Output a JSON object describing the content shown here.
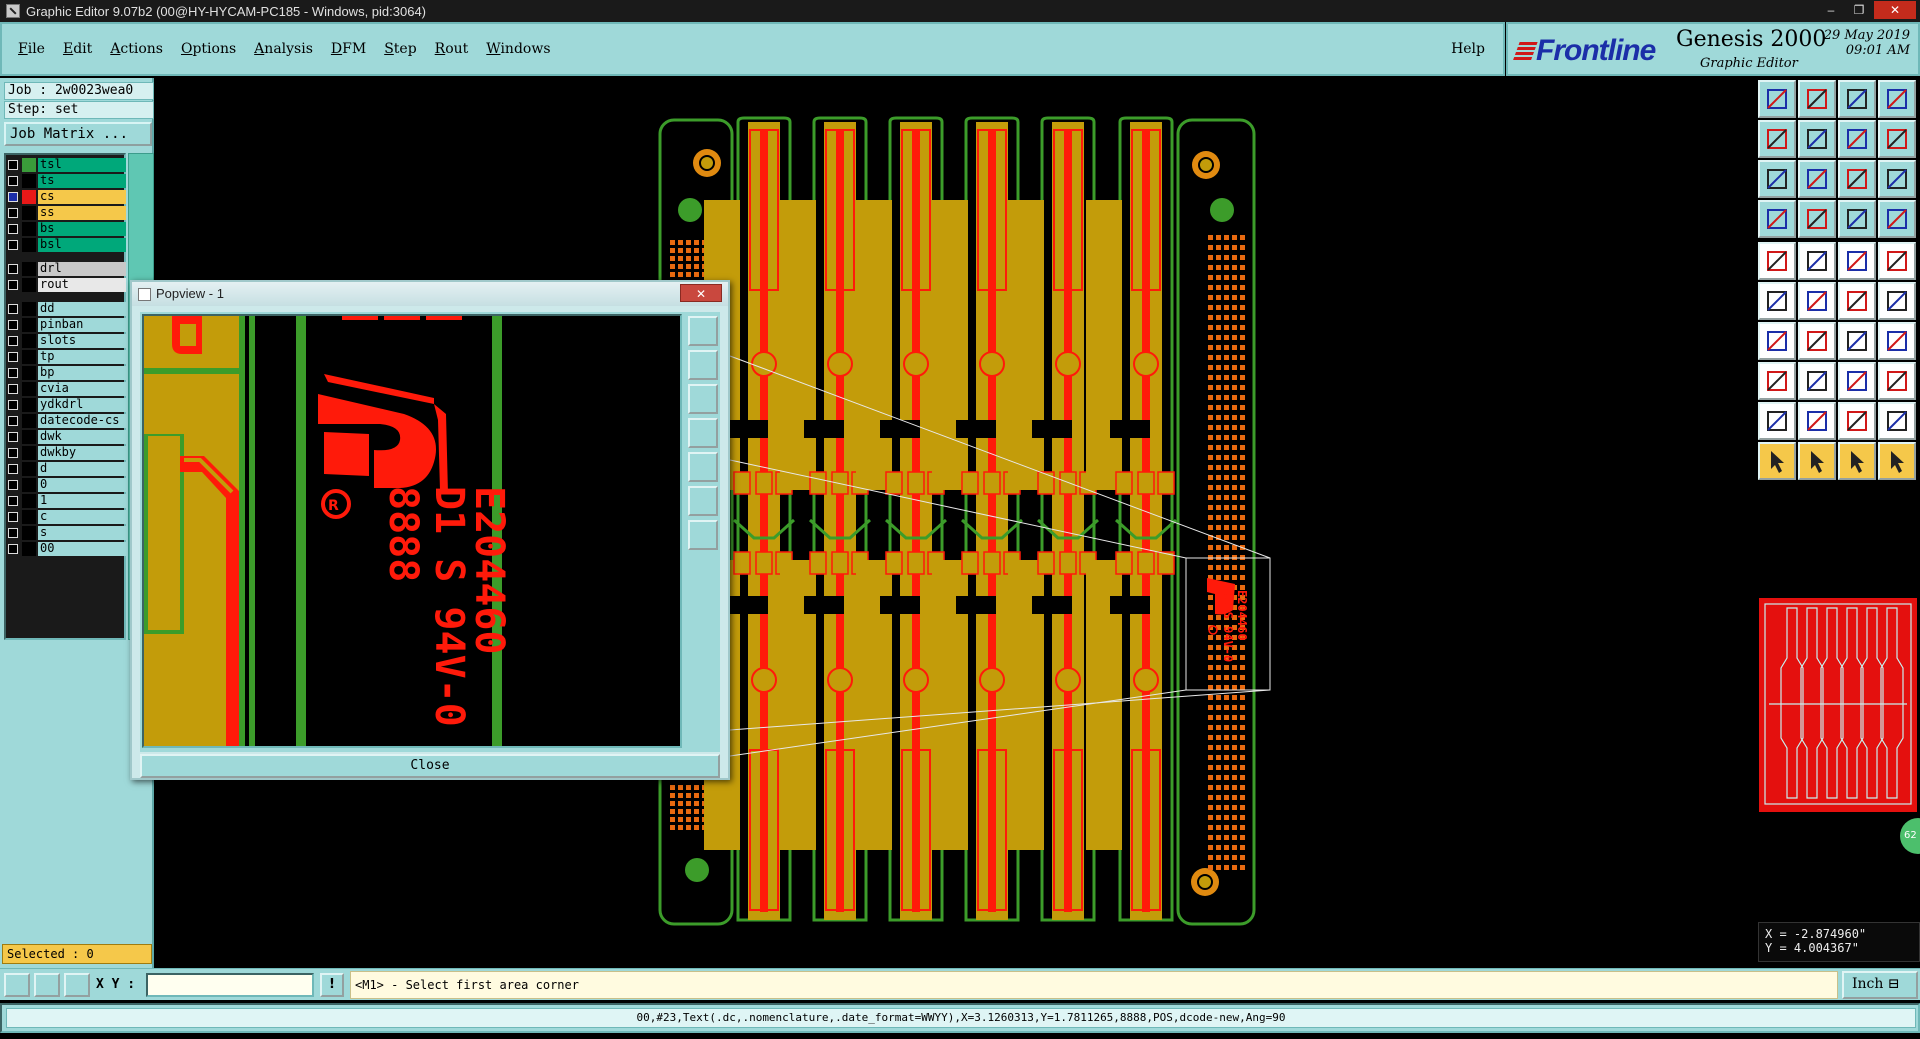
{
  "window": {
    "title": "Graphic Editor 9.07b2 (00@HY-HYCAM-PC185 - Windows, pid:3064)",
    "min_label": "–",
    "max_label": "❐",
    "close_label": "✕"
  },
  "menu": {
    "items": [
      "File",
      "Edit",
      "Actions",
      "Options",
      "Analysis",
      "DFM",
      "Step",
      "Rout",
      "Windows"
    ],
    "help": "Help"
  },
  "branding": {
    "logo": "Frontline",
    "product": "Genesis 2000",
    "subtitle": "Graphic Editor",
    "date": "29 May 2019",
    "time": "09:01 AM"
  },
  "left_panel": {
    "job": "Job : 2w0023wea0",
    "step": "Step: set",
    "job_matrix_label": "Job Matrix ...",
    "layers": [
      {
        "name": "tsl",
        "color": "#00a87a",
        "swatch": "#3a9c3a",
        "active": false
      },
      {
        "name": "ts",
        "color": "#00a87a",
        "swatch": "#000000",
        "active": false
      },
      {
        "name": "cs",
        "color": "#f5c84a",
        "swatch": "#e81818",
        "active": true
      },
      {
        "name": "ss",
        "color": "#f5c84a",
        "swatch": "#000000",
        "active": false
      },
      {
        "name": "bs",
        "color": "#00a87a",
        "swatch": "#000000",
        "active": false
      },
      {
        "name": "bsl",
        "color": "#00a87a",
        "swatch": "#000000",
        "active": false
      },
      {
        "name": "drl",
        "color": "#c8c8c8",
        "swatch": "#000000",
        "active": false
      },
      {
        "name": "rout",
        "color": "#e8e8e8",
        "swatch": "#000000",
        "active": false
      },
      {
        "name": "dd",
        "color": "#9fd9d9",
        "swatch": "#000000",
        "active": false
      },
      {
        "name": "pinban",
        "color": "#9fd9d9",
        "swatch": "#000000",
        "active": false
      },
      {
        "name": "slots",
        "color": "#9fd9d9",
        "swatch": "#000000",
        "active": false
      },
      {
        "name": "tp",
        "color": "#9fd9d9",
        "swatch": "#000000",
        "active": false
      },
      {
        "name": "bp",
        "color": "#9fd9d9",
        "swatch": "#000000",
        "active": false
      },
      {
        "name": "cvia",
        "color": "#9fd9d9",
        "swatch": "#000000",
        "active": false
      },
      {
        "name": "ydkdrl",
        "color": "#9fd9d9",
        "swatch": "#000000",
        "active": false
      },
      {
        "name": "datecode-cs",
        "color": "#9fd9d9",
        "swatch": "#000000",
        "active": false
      },
      {
        "name": "dwk",
        "color": "#9fd9d9",
        "swatch": "#000000",
        "active": false
      },
      {
        "name": "dwkby",
        "color": "#9fd9d9",
        "swatch": "#000000",
        "active": false
      },
      {
        "name": "d",
        "color": "#9fd9d9",
        "swatch": "#000000",
        "active": false
      },
      {
        "name": "0",
        "color": "#9fd9d9",
        "swatch": "#000000",
        "active": false
      },
      {
        "name": "1",
        "color": "#9fd9d9",
        "swatch": "#000000",
        "active": false
      },
      {
        "name": "c",
        "color": "#9fd9d9",
        "swatch": "#000000",
        "active": false
      },
      {
        "name": "s",
        "color": "#9fd9d9",
        "swatch": "#000000",
        "active": false
      },
      {
        "name": "00",
        "color": "#9fd9d9",
        "swatch": "#000000",
        "active": false
      }
    ],
    "selected": "Selected : 0"
  },
  "popview": {
    "title": "Popview - 1",
    "close_button": "Close",
    "marking_lines": [
      "E204460",
      "D1 S 94V-0",
      "8888"
    ]
  },
  "board": {
    "marking_lines": [
      "E204460",
      "D1 S 94V-0"
    ],
    "colors": {
      "substrate": "#c39c0a",
      "outline": "#3c9c2a",
      "copper": "#ff1a0a"
    }
  },
  "right_panel": {
    "coord_x": "X = -2.874960\"",
    "coord_y": "Y =  4.004367\"",
    "badge": "62"
  },
  "command_bar": {
    "xy_label": "X Y :",
    "xy_value": "",
    "excl": "!",
    "prompt": "<M1> - Select first area corner",
    "units": "Inch"
  },
  "status_bar": {
    "text": "00,#23,Text(.dc,.nomenclature,.date_format=WWYY),X=3.1260313,Y=1.7811265,8888,POS,dcode-new,Ang=90"
  }
}
